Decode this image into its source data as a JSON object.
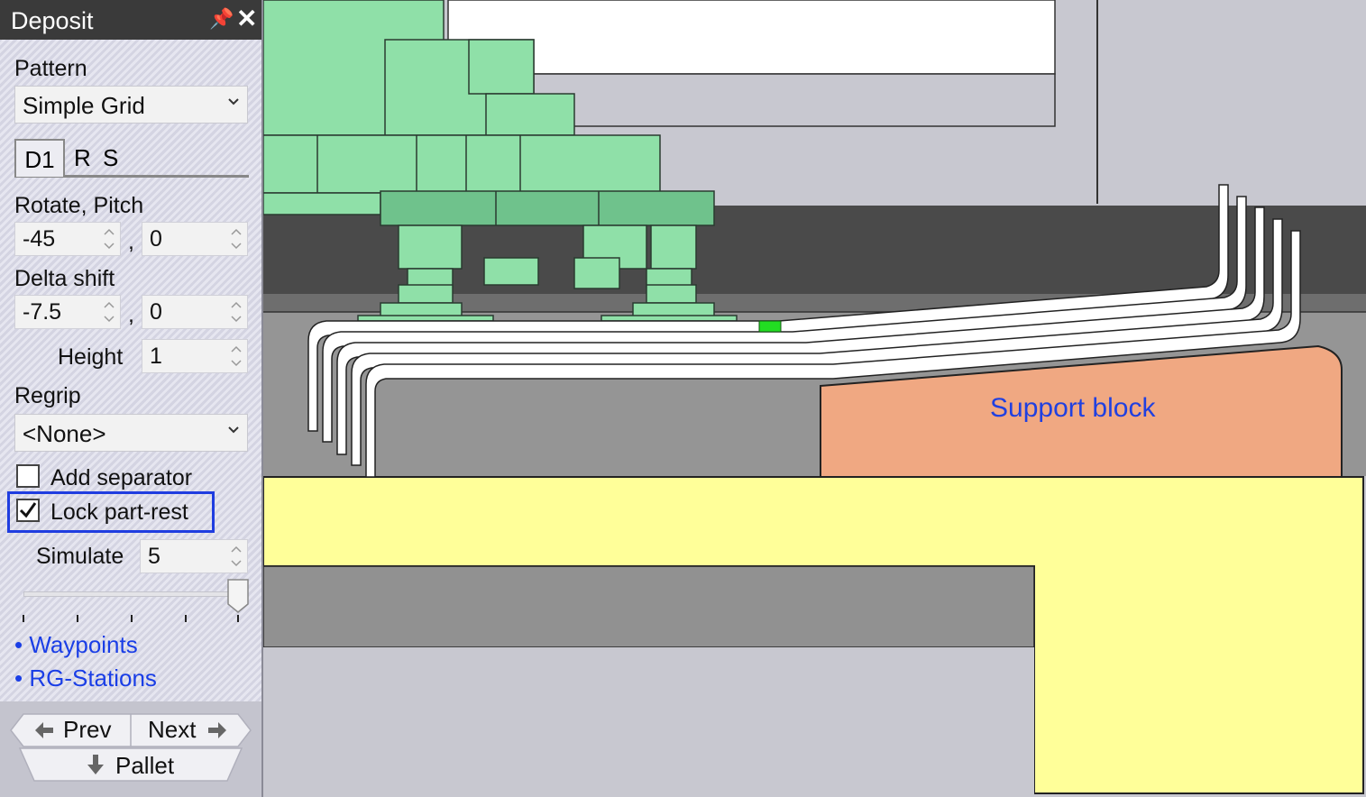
{
  "panel": {
    "title": "Deposit",
    "pattern_label": "Pattern",
    "pattern_value": "Simple Grid",
    "tabs": [
      {
        "label": "D1",
        "active": true
      },
      {
        "label": "R"
      },
      {
        "label": "S"
      }
    ],
    "rotate_pitch_label": "Rotate, Pitch",
    "rotate_value": "-45",
    "pitch_value": "0",
    "delta_shift_label": "Delta shift",
    "delta_x_value": "-7.5",
    "delta_y_value": "0",
    "separator": ",",
    "height_label": "Height",
    "height_value": "1",
    "regrip_label": "Regrip",
    "regrip_value": "<None>",
    "add_separator_label": "Add separator",
    "add_separator_checked": false,
    "lock_part_rest_label": "Lock part-rest",
    "lock_part_rest_checked": true,
    "simulate_label": "Simulate",
    "simulate_value": "5",
    "simulate_slider_fraction": 1.0,
    "links": [
      "• Waypoints",
      "• RG-Stations"
    ],
    "prev_label": "Prev",
    "next_label": "Next",
    "pallet_label": "Pallet"
  },
  "viewport": {
    "support_block_label": "Support block",
    "colors": {
      "gripper": "#8fe0a8",
      "support_block": "#f0a882",
      "table": "#ffff99",
      "parts": "#ffffff",
      "highlight": "#1f3de0",
      "link": "#1a3ee6"
    }
  }
}
